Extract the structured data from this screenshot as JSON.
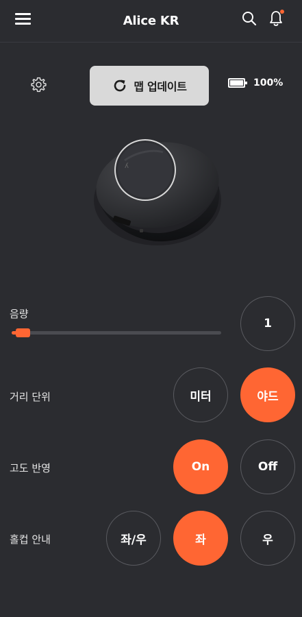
{
  "header": {
    "title": "Alice KR"
  },
  "toolbar": {
    "update_label": "맵 업데이트",
    "battery_text": "100%",
    "battery_level": 1.0
  },
  "volume": {
    "label": "음량",
    "value": "1",
    "level": 0.02
  },
  "distance_unit": {
    "label": "거리 단위",
    "options": [
      "미터",
      "야드"
    ],
    "selected": "야드"
  },
  "elevation": {
    "label": "고도 반영",
    "options": [
      "On",
      "Off"
    ],
    "selected": "On"
  },
  "cup_guide": {
    "label": "홀컵 안내",
    "options": [
      "좌/우",
      "좌",
      "우"
    ],
    "selected": "좌"
  },
  "colors": {
    "accent": "#ff6633",
    "background": "#2b2c30",
    "button_light": "#d9d9d9"
  },
  "icons": [
    "menu-icon",
    "search-icon",
    "bell-icon",
    "settings-icon",
    "refresh-icon",
    "battery-icon"
  ]
}
